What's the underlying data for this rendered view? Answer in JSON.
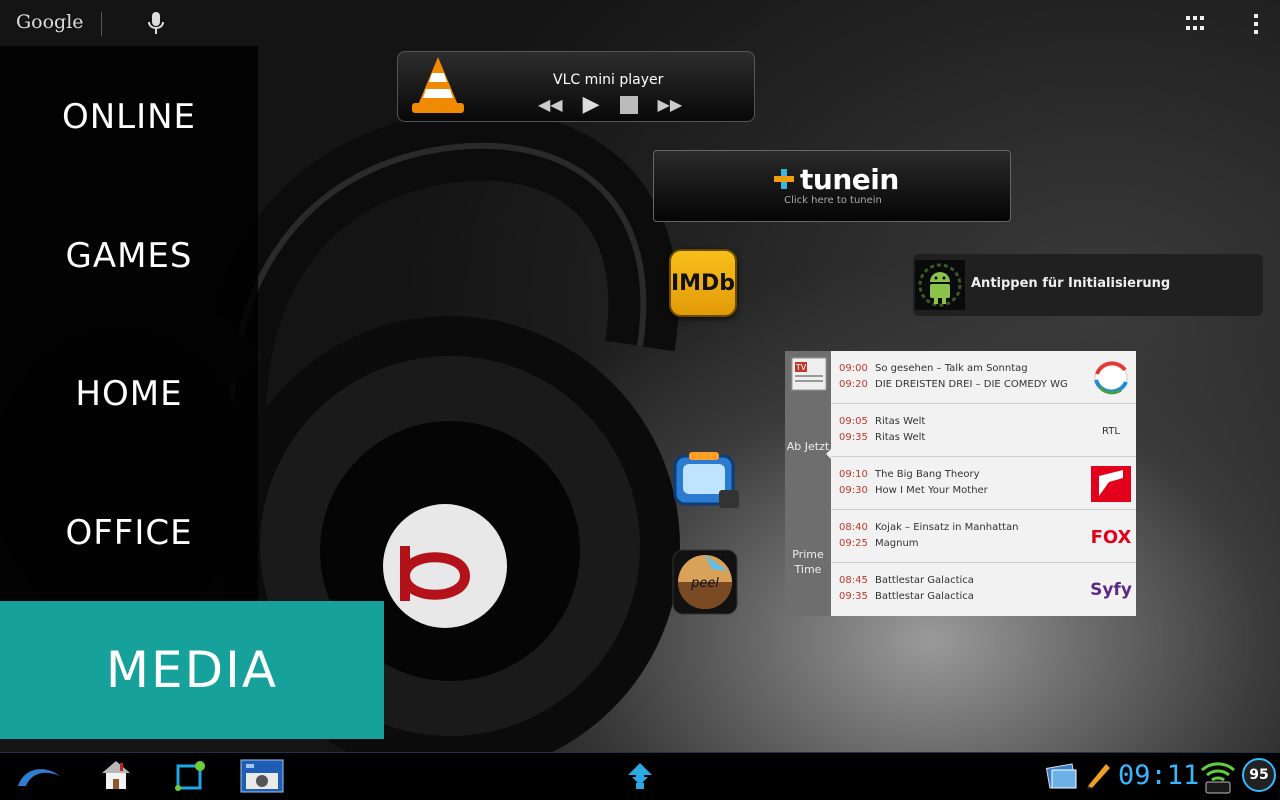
{
  "top_bar": {
    "search_label": "Google"
  },
  "menu": {
    "items": [
      "ONLINE",
      "GAMES",
      "HOME",
      "OFFICE"
    ],
    "active": "MEDIA",
    "active_color": "#16a19a"
  },
  "widgets": {
    "vlc": {
      "title": "VLC mini player",
      "controls": [
        "rewind",
        "play",
        "stop",
        "fast-forward"
      ]
    },
    "tunein": {
      "logo": "tunein",
      "subtitle": "Click here to tunein"
    },
    "imdb": {
      "label": "IMDb"
    },
    "android_init": {
      "label": "Antippen für Initialisierung"
    },
    "tv_guide": {
      "logo": "TV",
      "now_label": "Ab Jetzt",
      "prime_label": "Prime Time",
      "rows": [
        {
          "time1": "09:00",
          "show1": "So gesehen – Talk am Sonntag",
          "time2": "09:20",
          "show2": "DIE DREISTEN DREI – DIE COMEDY WG",
          "channel": "SAT.1"
        },
        {
          "time1": "09:05",
          "show1": "Ritas Welt",
          "time2": "09:35",
          "show2": "Ritas Welt",
          "channel": "RTL"
        },
        {
          "time1": "09:10",
          "show1": "The Big Bang Theory",
          "time2": "09:30",
          "show2": "How I Met Your Mother",
          "channel": "ProSieben"
        },
        {
          "time1": "08:40",
          "show1": "Kojak – Einsatz in Manhattan",
          "time2": "09:25",
          "show2": "Magnum",
          "channel": "FOX"
        },
        {
          "time1": "08:45",
          "show1": "Battlestar Galactica",
          "time2": "09:35",
          "show2": "Battlestar Galactica",
          "channel": "Syfy"
        }
      ]
    }
  },
  "status_bar": {
    "clock": "09:11",
    "battery": "95",
    "accent": "#37b7ff"
  },
  "icons": [
    "mic-icon",
    "apps-grid-icon",
    "overflow-menu-icon",
    "back-icon",
    "home-icon",
    "recent-apps-icon",
    "screenshot-icon",
    "app-drawer-icon",
    "gallery-icon",
    "pencil-icon",
    "wifi-icon"
  ]
}
